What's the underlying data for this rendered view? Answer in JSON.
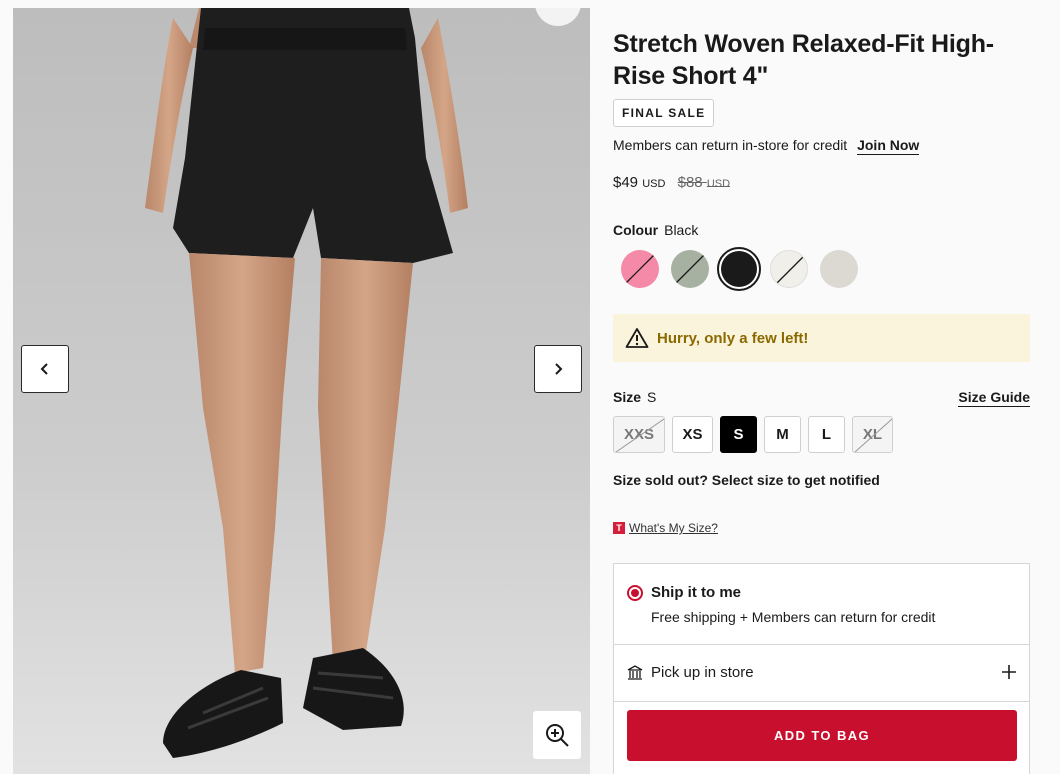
{
  "gallery": {
    "prev_icon": "chevron-left-icon",
    "next_icon": "chevron-right-icon",
    "zoom_icon": "zoom-in-icon"
  },
  "product": {
    "title": "Stretch Woven Relaxed-Fit High-Rise Short 4\"",
    "badge": "FINAL SALE",
    "members_text": "Members can return in-store for credit",
    "join_link": "Join Now",
    "price": "$49",
    "price_currency": "USD",
    "was_price": "$88",
    "was_currency": "USD"
  },
  "colour": {
    "label": "Colour",
    "selected": "Black",
    "swatches": [
      {
        "color": "#f48aa8",
        "available": false
      },
      {
        "color": "#a7b1a2",
        "available": false
      },
      {
        "color": "#1a1a1a",
        "available": true,
        "selected": true
      },
      {
        "color": "#f0efe9",
        "available": false
      },
      {
        "color": "#dcd9d3",
        "available": true
      }
    ]
  },
  "alert": {
    "icon": "warning-icon",
    "text": "Hurry, only a few left!",
    "color": "#8a6a00"
  },
  "size": {
    "label": "Size",
    "selected": "S",
    "guide": "Size Guide",
    "options": [
      {
        "label": "XXS",
        "available": false
      },
      {
        "label": "XS",
        "available": true
      },
      {
        "label": "S",
        "available": true,
        "selected": true
      },
      {
        "label": "M",
        "available": true
      },
      {
        "label": "L",
        "available": true
      },
      {
        "label": "XL",
        "available": false
      }
    ],
    "sold_out_note": "Size sold out? Select size to get notified",
    "whats_my_size_badge": "T",
    "whats_my_size": "What's My Size?"
  },
  "delivery": {
    "ship_title": "Ship it to me",
    "ship_sub": "Free shipping + Members can return for credit",
    "pickup_title": "Pick up in store",
    "store_icon": "store-icon",
    "expand_icon": "plus-icon"
  },
  "cta": {
    "add_to_bag": "ADD TO BAG",
    "color": "#c8102e"
  }
}
